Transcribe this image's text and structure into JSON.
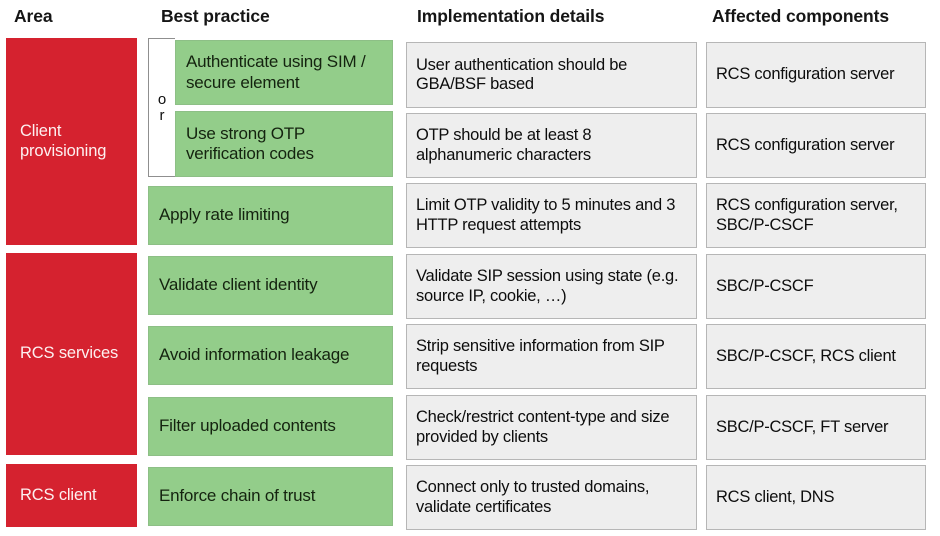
{
  "title": "RCS security best practices table",
  "colors": {
    "area_background": "#d5222f",
    "area_text": "#fdf0f0",
    "practice_background": "#93cd8a",
    "practice_border": "#8dbf86",
    "practice_text": "#14230f",
    "detail_background": "#eeeeee",
    "detail_border": "#b6b6b6",
    "page_background": "#ffffff"
  },
  "headers": {
    "area": "Area",
    "best_practice": "Best practice",
    "implementation_details": "Implementation details",
    "affected_components": "Affected components"
  },
  "connector": {
    "label": "or",
    "letters": [
      "o",
      "r"
    ]
  },
  "areas": [
    {
      "id": "client-provisioning",
      "label": "Client provisioning"
    },
    {
      "id": "rcs-services",
      "label": "RCS services"
    },
    {
      "id": "rcs-client",
      "label": "RCS client"
    }
  ],
  "rows": [
    {
      "area": "Client provisioning",
      "best_practice": "Authenticate using SIM / secure element",
      "implementation_details": "User authentication should be GBA/BSF based",
      "affected_components": "RCS configuration server"
    },
    {
      "area": "Client provisioning",
      "best_practice": "Use strong OTP verification codes",
      "implementation_details": "OTP should be at least 8 alphanumeric characters",
      "affected_components": "RCS configuration server"
    },
    {
      "area": "Client provisioning",
      "best_practice": "Apply rate limiting",
      "implementation_details": "Limit OTP validity to 5 minutes and 3 HTTP request attempts",
      "affected_components": "RCS configuration server, SBC/P-CSCF"
    },
    {
      "area": "RCS services",
      "best_practice": "Validate client identity",
      "implementation_details": "Validate SIP session using state (e.g. source IP, cookie, …)",
      "affected_components": "SBC/P-CSCF"
    },
    {
      "area": "RCS services",
      "best_practice": "Avoid information leakage",
      "implementation_details": "Strip sensitive information from SIP requests",
      "affected_components": "SBC/P-CSCF, RCS client"
    },
    {
      "area": "RCS services",
      "best_practice": "Filter uploaded contents",
      "implementation_details": "Check/restrict content-type and size provided by clients",
      "affected_components": "SBC/P-CSCF, FT server"
    },
    {
      "area": "RCS client",
      "best_practice": "Enforce chain of trust",
      "implementation_details": "Connect only to trusted domains, validate certificates",
      "affected_components": "RCS client, DNS"
    }
  ]
}
